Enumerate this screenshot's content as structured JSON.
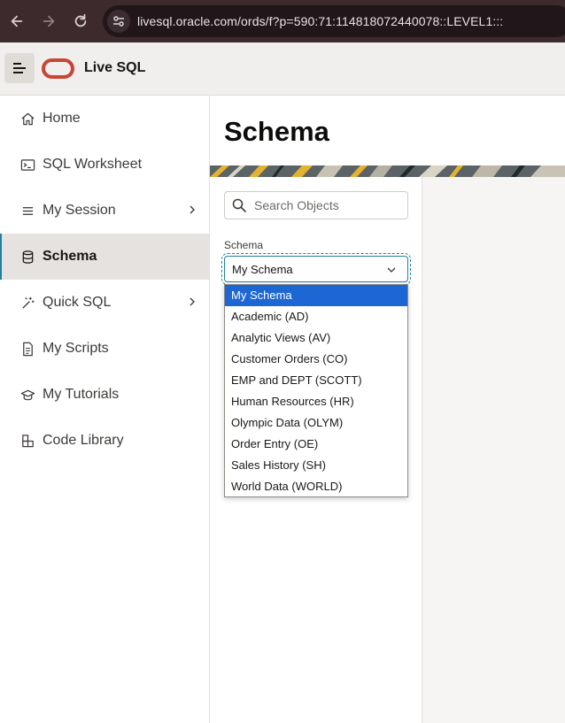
{
  "browser": {
    "url": "livesql.oracle.com/ords/f?p=590:71:114818072440078::LEVEL1:::"
  },
  "header": {
    "app_title": "Live SQL",
    "brand_color": "#c74634"
  },
  "sidebar": {
    "items": [
      {
        "label": "Home",
        "icon": "home-icon"
      },
      {
        "label": "SQL Worksheet",
        "icon": "terminal-icon"
      },
      {
        "label": "My Session",
        "icon": "list-icon",
        "has_submenu": true
      },
      {
        "label": "Schema",
        "icon": "database-icon",
        "active": true
      },
      {
        "label": "Quick SQL",
        "icon": "magic-wand-icon",
        "has_submenu": true
      },
      {
        "label": "My Scripts",
        "icon": "document-icon"
      },
      {
        "label": "My Tutorials",
        "icon": "graduation-cap-icon"
      },
      {
        "label": "Code Library",
        "icon": "library-icon"
      }
    ]
  },
  "main": {
    "title": "Schema",
    "search": {
      "placeholder": "Search Objects",
      "value": ""
    },
    "schema_field": {
      "label": "Schema",
      "selected": "My Schema",
      "options": [
        "My Schema",
        "Academic (AD)",
        "Analytic Views (AV)",
        "Customer Orders (CO)",
        "EMP and DEPT (SCOTT)",
        "Human Resources (HR)",
        "Olympic Data (OLYM)",
        "Order Entry (OE)",
        "Sales History (SH)",
        "World Data (WORLD)"
      ]
    }
  },
  "colors": {
    "accent": "#227e9e",
    "option_highlight": "#1d67d4"
  }
}
